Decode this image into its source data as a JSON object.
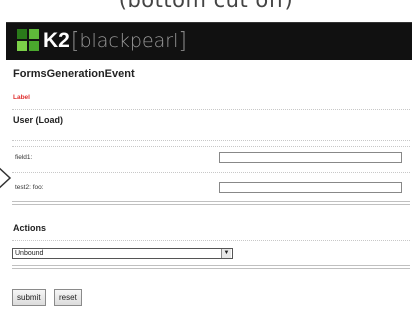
{
  "top_caption": "(bottom cut off)",
  "banner": {
    "logo_k2": "K2",
    "logo_open": "[",
    "logo_text": "blackpearl",
    "logo_close": "]"
  },
  "form": {
    "title": "FormsGenerationEvent",
    "label_text": "Label",
    "section_user": "User (Load)",
    "fields": [
      {
        "label": "field1:",
        "value": ""
      },
      {
        "label": "test2: foo:",
        "value": ""
      }
    ],
    "section_actions": "Actions",
    "actions_select": {
      "selected": "Unbound"
    },
    "buttons": {
      "submit": "submit",
      "reset": "reset"
    }
  },
  "colors": {
    "banner_bg": "#111111",
    "label_red": "#e03030",
    "logo_green_dark": "#2a7a1a",
    "logo_green_light": "#7bd048"
  }
}
